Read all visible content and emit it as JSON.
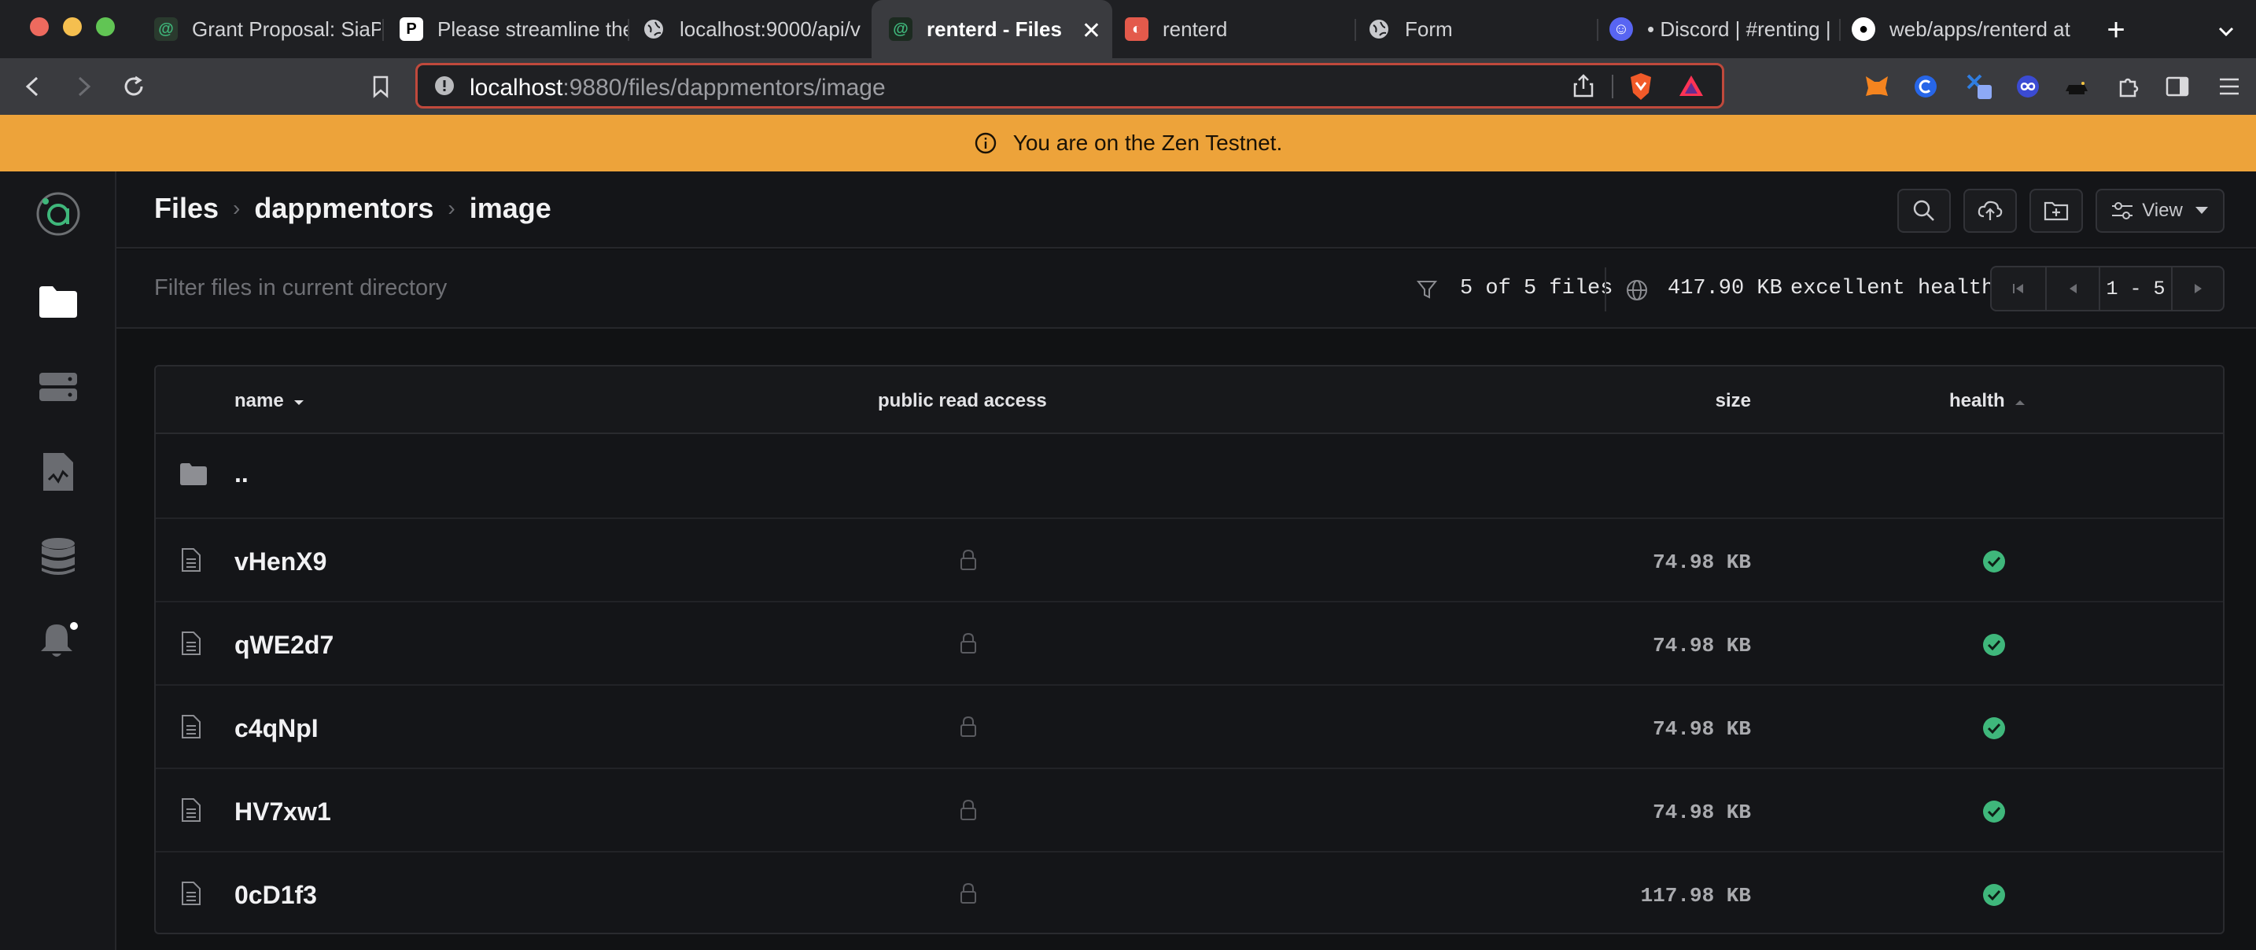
{
  "browser": {
    "tabs": [
      {
        "label": "Grant Proposal: SiaP"
      },
      {
        "label": "Please streamline the"
      },
      {
        "label": "localhost:9000/api/v"
      },
      {
        "label": "renterd - Files"
      },
      {
        "label": "renterd"
      },
      {
        "label": "Form"
      },
      {
        "label": "• Discord | #renting |"
      },
      {
        "label": "web/apps/renterd at"
      }
    ],
    "url_host": "localhost",
    "url_path": ":9880/files/dappmentors/image"
  },
  "banner": {
    "text": "You are on the Zen Testnet."
  },
  "header": {
    "crumbs": [
      "Files",
      "dappmentors",
      "image"
    ],
    "view_label": "View"
  },
  "filter": {
    "placeholder": "Filter files in current directory",
    "count_text": "5 of 5 files",
    "size_text": "417.90 KB",
    "health_text": "excellent health",
    "page_range": "1 - 5"
  },
  "table": {
    "columns": {
      "name": "name",
      "public": "public read access",
      "size": "size",
      "health": "health"
    },
    "parent_label": "..",
    "rows": [
      {
        "name": "vHenX9",
        "size": "74.98 KB"
      },
      {
        "name": "qWE2d7",
        "size": "74.98 KB"
      },
      {
        "name": "c4qNpI",
        "size": "74.98 KB"
      },
      {
        "name": "HV7xw1",
        "size": "74.98 KB"
      },
      {
        "name": "0cD1f3",
        "size": "117.98 KB"
      }
    ]
  },
  "colors": {
    "banner": "#eda33a",
    "accent": "#3fb77b",
    "url_outline": "#c0493c"
  }
}
